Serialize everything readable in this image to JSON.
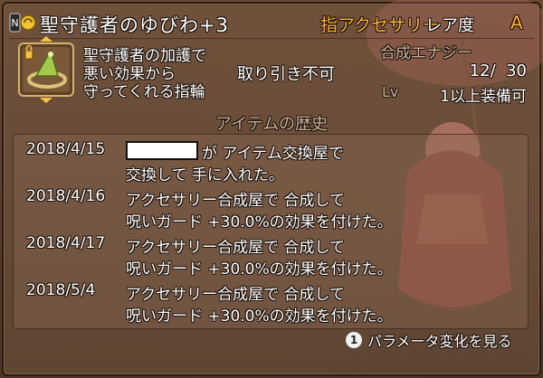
{
  "item": {
    "icon_badge": "N",
    "name": "聖守護者のゆびわ+3",
    "category": "指アクセサリー",
    "rarity_label": "レア度",
    "rarity_value": "A",
    "icon": "ring-icon",
    "description": [
      "聖守護者の加護で",
      "悪い効果から",
      "守ってくれる指輪"
    ],
    "tradability": "取り引き不可",
    "synthesis_label": "合成エナジー",
    "synthesis_value": "12/  30",
    "level_label": "Lv",
    "level_value": "1以上装備可"
  },
  "history": {
    "title": "アイテムの歴史",
    "entries": [
      {
        "date": "2018/4/15",
        "line1": "が アイテム交換屋で",
        "line2": "交換して 手に入れた。"
      },
      {
        "date": "2018/4/16",
        "line1": "アクセサリー合成屋で 合成して",
        "line2": "呪いガード +30.0%の効果を付けた。"
      },
      {
        "date": "2018/4/17",
        "line1": "アクセサリー合成屋で 合成して",
        "line2": "呪いガード +30.0%の効果を付けた。"
      },
      {
        "date": "2018/5/4",
        "line1": "アクセサリー合成屋で 合成して",
        "line2": "呪いガード +30.0%の効果を付けた。"
      }
    ]
  },
  "footer": {
    "button_glyph": "1",
    "label": "パラメータ変化を見る"
  },
  "colors": {
    "accent": "#ffb23a",
    "muted": "#c9b39c",
    "text": "#ffffff"
  }
}
